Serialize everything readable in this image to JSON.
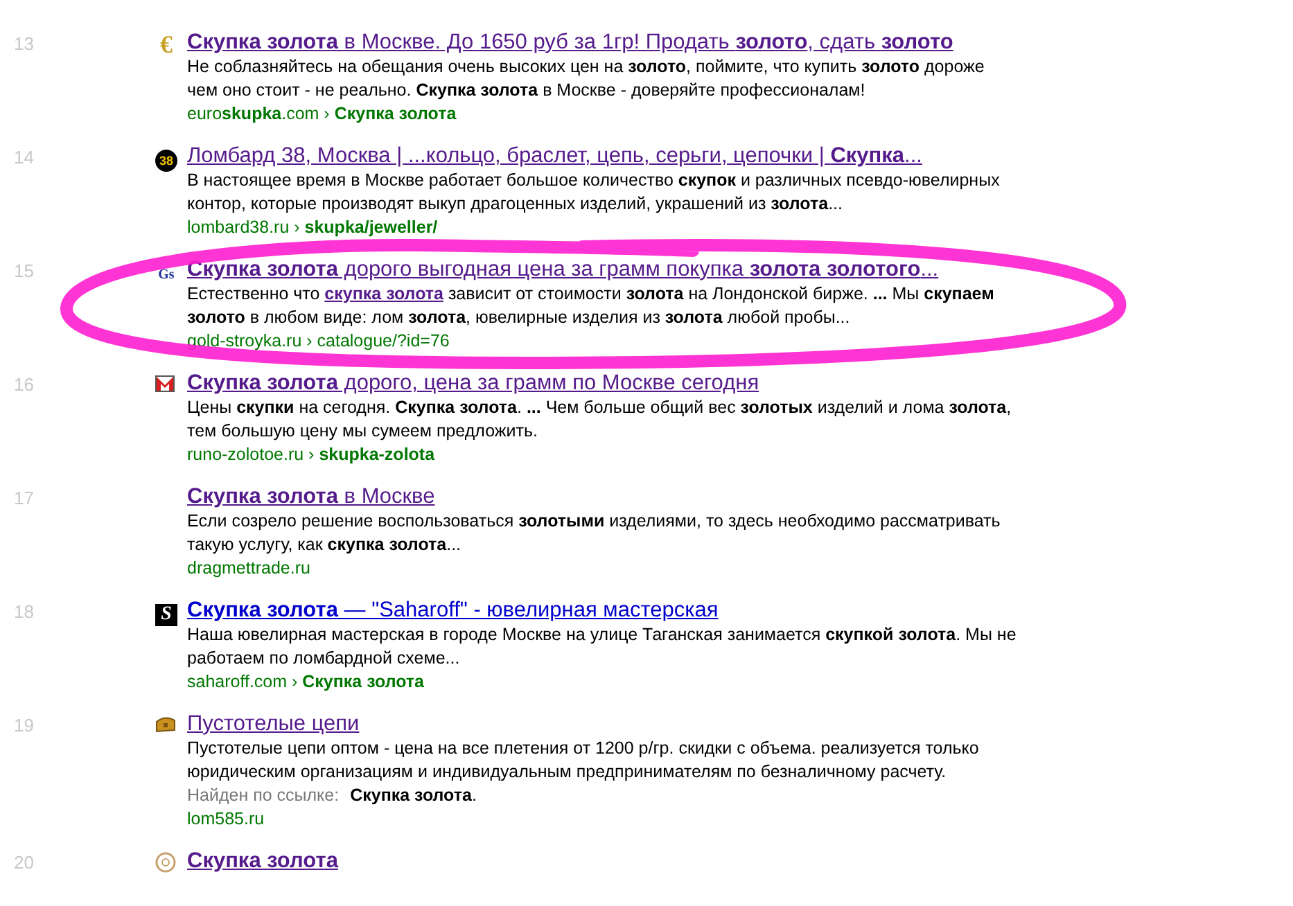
{
  "results": [
    {
      "number": "13",
      "visited": true,
      "icon": {
        "kind": "euro",
        "label": "€"
      },
      "title": "**Скупка золота** в Москве. До 1650 руб за 1гр! Продать **золото**, сдать **золото**",
      "snippet": [
        {
          "kind": "text",
          "text": "Не соблазняйтесь на обещания очень высоких цен на **золото**, поймите, что купить **золото** дороже чем оно стоит - не реально. **Скупка золота** в Москве - доверяйте профессионалам!"
        }
      ],
      "url": "euro**skupka**.com › **Скупка золота**"
    },
    {
      "number": "14",
      "visited": true,
      "icon": {
        "kind": "badge",
        "label": "38"
      },
      "title": "Ломбард 38, Москва | ...кольцо, браслет, цепь, серьги, цепочки | **Скупка**...",
      "snippet": [
        {
          "kind": "text",
          "text": "В настоящее время в Москве работает большое количество **скупок** и различных псевдо-ювелирных контор, которые производят выкуп драгоценных изделий, украшений из **золота**..."
        }
      ],
      "url": "lombard38.ru › **skupka/jeweller/**"
    },
    {
      "number": "15",
      "visited": true,
      "icon": {
        "kind": "letters",
        "label": "Gs"
      },
      "title": "**Скупка золота** дорого выгодная цена за грамм покупка **золота золотого**...",
      "snippet": [
        {
          "kind": "text",
          "text": "Естественно что "
        },
        {
          "kind": "link",
          "text": "скупка золота"
        },
        {
          "kind": "text",
          "text": " зависит от стоимости **золота** на Лондонской бирже. **...** Мы **скупаем золото** в любом виде: лом **золота**, ювелирные изделия из **золота** любой пробы..."
        }
      ],
      "url": "gold-stroyka.ru › catalogue/?id=76"
    },
    {
      "number": "16",
      "visited": true,
      "icon": {
        "kind": "mail"
      },
      "title": "**Скупка золота** дорого, цена за грамм по Москве сегодня",
      "snippet": [
        {
          "kind": "text",
          "text": "Цены **скупки** на сегодня. **Скупка золота**. **...** Чем больше общий вес **золотых** изделий и лома **золота**, тем большую цену мы сумеем предложить."
        }
      ],
      "url": "runo-zolotoe.ru › **skupka-zolota**"
    },
    {
      "number": "17",
      "visited": true,
      "icon": {
        "kind": "none"
      },
      "title": "**Скупка золота** в Москве",
      "snippet": [
        {
          "kind": "text",
          "text": "Если созрело решение воспользоваться **золотыми** изделиями, то здесь необходимо рассматривать такую услугу, как **скупка золота**..."
        }
      ],
      "url": "dragmettrade.ru"
    },
    {
      "number": "18",
      "visited": false,
      "icon": {
        "kind": "square",
        "label": "S"
      },
      "title": "**Скупка золота** — \"Saharoff\" - ювелирная мастерская",
      "snippet": [
        {
          "kind": "text",
          "text": "Наша ювелирная мастерская в городе Москве на улице Таганская занимается **скупкой золота**. Мы не работаем по ломбардной схеме..."
        }
      ],
      "url": "saharoff.com › **Скупка золота**"
    },
    {
      "number": "19",
      "visited": true,
      "icon": {
        "kind": "chest"
      },
      "title": "Пустотелые цепи",
      "snippet": [
        {
          "kind": "text",
          "text": "Пустотелые цепи оптом - цена на все плетения от 1200 р/гр. скидки с объема. реализуется только юридическим организациям и индивидуальным предпринимателям по безналичному расчету."
        }
      ],
      "found_by": {
        "label": "Найден по ссылке:",
        "text": "**Скупка золота**."
      },
      "url": "lom585.ru"
    },
    {
      "number": "20",
      "visited": true,
      "icon": {
        "kind": "target"
      },
      "title": "**Скупка золота**"
    }
  ]
}
